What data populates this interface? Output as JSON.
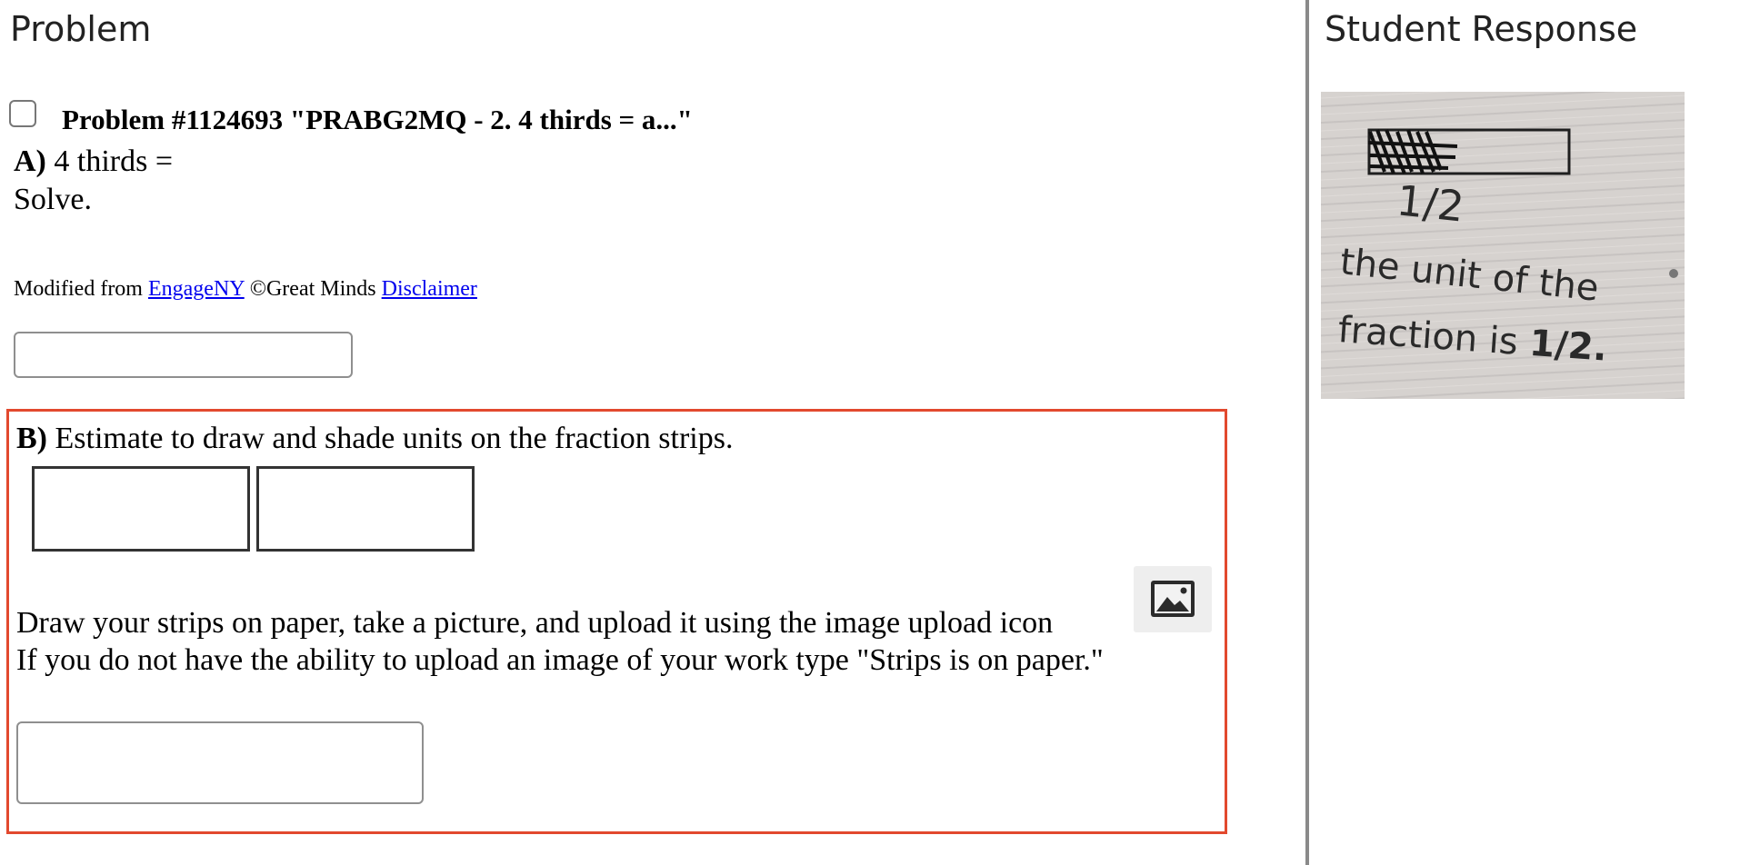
{
  "left_pane": {
    "heading": "Problem",
    "problem": {
      "title": "Problem #1124693 \"PRABG2MQ - 2. 4 thirds = a...\"",
      "part_a": {
        "label": "A)",
        "question": "4 thirds =",
        "instruction": "Solve.",
        "attribution": {
          "prefix": "Modified from",
          "link_engageny": "EngageNY",
          "copyright": "©Great Minds",
          "link_disclaimer": "Disclaimer"
        },
        "answer_value": ""
      },
      "part_b": {
        "label": "B)",
        "question": "Estimate to draw and shade units on the fraction strips.",
        "instruction_line1": "Draw your strips on paper, take a picture, and upload it using the image upload icon",
        "instruction_line2": "If you do not have the ability to upload an image of your work type \"Strips is on paper.\"",
        "answer_value": ""
      }
    }
  },
  "right_pane": {
    "heading": "Student Response",
    "image": {
      "handwriting_fraction": "1/2",
      "handwriting_line1": "the unit of the",
      "handwriting_line2": "fraction is",
      "handwriting_answer": "1/2."
    }
  },
  "colors": {
    "highlight_border": "#e2492e",
    "link": "#0000ee",
    "divider": "#8a8a8a"
  },
  "icons": {
    "upload": "image-upload-icon",
    "checkbox": "checkbox-icon",
    "resize": "resize-handle-icon"
  }
}
